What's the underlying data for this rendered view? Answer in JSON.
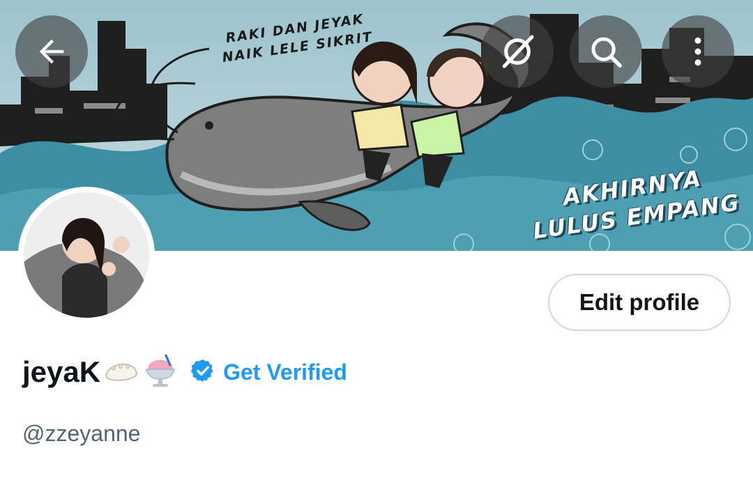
{
  "header": {
    "back_icon": "arrow-left-icon",
    "grok_icon": "grok-icon",
    "search_icon": "search-icon",
    "more_icon": "more-vertical-icon",
    "banner": {
      "caption_top": "RAKI DAN JEYAK NAIK LELE SIKRIT",
      "caption_bottom": "AKHIRNYA LULUS EMPANG"
    }
  },
  "profile": {
    "display_name": "jeyaK",
    "handle": "@zzeyanne",
    "verified_badge_icon": "verified-badge-icon",
    "get_verified_label": "Get Verified",
    "edit_profile_label": "Edit profile"
  },
  "colors": {
    "accent": "#1d9bf0",
    "text_primary": "#0f1419",
    "text_secondary": "#536471",
    "button_border": "#cfd9de"
  }
}
